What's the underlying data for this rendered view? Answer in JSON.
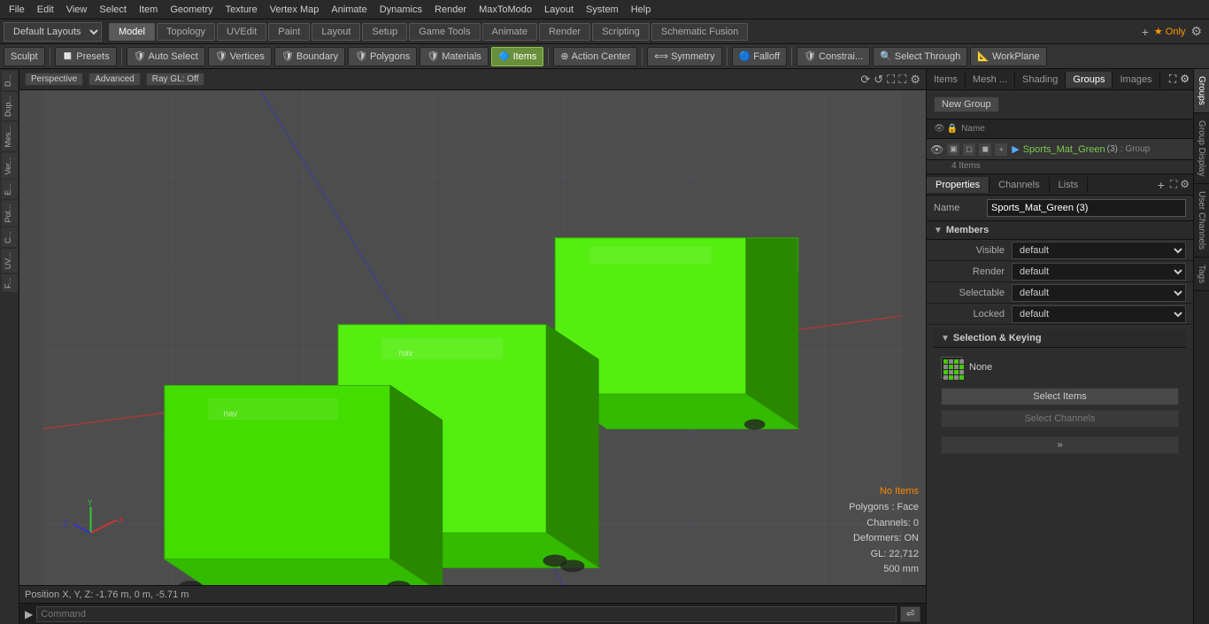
{
  "menubar": {
    "items": [
      "File",
      "Edit",
      "View",
      "Select",
      "Item",
      "Geometry",
      "Texture",
      "Vertex Map",
      "Animate",
      "Dynamics",
      "Render",
      "MaxToModo",
      "Layout",
      "System",
      "Help"
    ]
  },
  "layout": {
    "dropdown": "Default Layouts",
    "tabs": [
      "Model",
      "Topology",
      "UVEdit",
      "Paint",
      "Layout",
      "Setup",
      "Game Tools",
      "Animate",
      "Render",
      "Scripting",
      "Schematic Fusion"
    ],
    "active_tab": "Model",
    "star_only": "★ Only"
  },
  "toolbar": {
    "sculpt": "Sculpt",
    "presets": "Presets",
    "auto_select": "Auto Select",
    "vertices": "Vertices",
    "boundary": "Boundary",
    "polygons": "Polygons",
    "materials": "Materials",
    "items": "Items",
    "action_center": "Action Center",
    "symmetry": "Symmetry",
    "falloff": "Falloff",
    "constraints": "Constrai...",
    "select_through": "Select Through",
    "workplane": "WorkPlane"
  },
  "viewport": {
    "mode": "Perspective",
    "advanced": "Advanced",
    "ray_gl": "Ray GL: Off",
    "status": {
      "no_items": "No Items",
      "polygons": "Polygons : Face",
      "channels": "Channels: 0",
      "deformers": "Deformers: ON",
      "gl": "GL: 22,712",
      "size": "500 mm"
    }
  },
  "position_bar": {
    "text": "Position X, Y, Z:  -1.76 m, 0 m, -5.71 m"
  },
  "right_panel": {
    "tabs": [
      "Items",
      "Mesh ...",
      "Shading",
      "Groups",
      "Images"
    ],
    "active_tab": "Groups",
    "new_group": "New Group",
    "name_header": "Name",
    "group": {
      "name": "Sports_Mat_Green",
      "number": "(3)",
      "type": ": Group",
      "items": "4 Items"
    }
  },
  "properties": {
    "tabs": [
      "Properties",
      "Channels",
      "Lists"
    ],
    "name_label": "Name",
    "name_value": "Sports_Mat_Green (3)",
    "members_label": "Members",
    "visible_label": "Visible",
    "visible_value": "default",
    "render_label": "Render",
    "render_value": "default",
    "selectable_label": "Selectable",
    "selectable_value": "default",
    "locked_label": "Locked",
    "locked_value": "default",
    "sel_keying_label": "Selection & Keying",
    "none_label": "None",
    "select_items": "Select Items",
    "select_channels": "Select Channels",
    "expand": "»"
  },
  "right_vtabs": [
    "Groups",
    "Group Display",
    "User Channels",
    "Tags"
  ],
  "command": {
    "label": "Command",
    "placeholder": "Command"
  }
}
